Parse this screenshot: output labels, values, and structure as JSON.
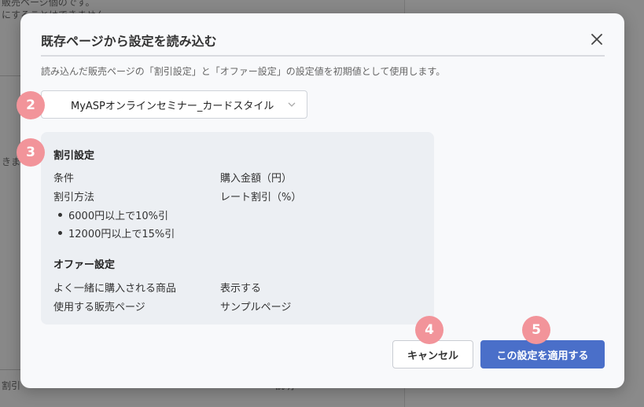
{
  "background": {
    "line1": "販売ページ個のです。",
    "line2": "にすることはできません",
    "line3": "きま",
    "line4": "割引",
    "line5": "説明"
  },
  "modal": {
    "title": "既存ページから設定を読み込む",
    "description": "読み込んだ販売ページの「割引設定」と「オファー設定」の設定値を初期値として使用します。",
    "select": {
      "value": "MyASPオンラインセミナー_カードスタイル"
    },
    "discount": {
      "title": "割引設定",
      "condition_label": "条件",
      "condition_value": "購入金額（円）",
      "method_label": "割引方法",
      "method_value": "レート割引（%）",
      "rules": [
        "6000円以上で10%引",
        "12000円以上で15%引"
      ]
    },
    "offer": {
      "title": "オファー設定",
      "frequent_label": "よく一緒に購入される商品",
      "frequent_value": "表示する",
      "page_label": "使用する販売ページ",
      "page_value": "サンプルページ"
    },
    "buttons": {
      "cancel": "キャンセル",
      "apply": "この設定を適用する"
    }
  },
  "badges": {
    "select": "2",
    "card": "3",
    "cancel": "4",
    "apply": "5"
  },
  "colors": {
    "badge": "#f2949a",
    "primary": "#4a6fc9",
    "card": "#eceff3"
  },
  "icons": {
    "close": "close-icon",
    "dropdown": "chevron-down-icon"
  }
}
